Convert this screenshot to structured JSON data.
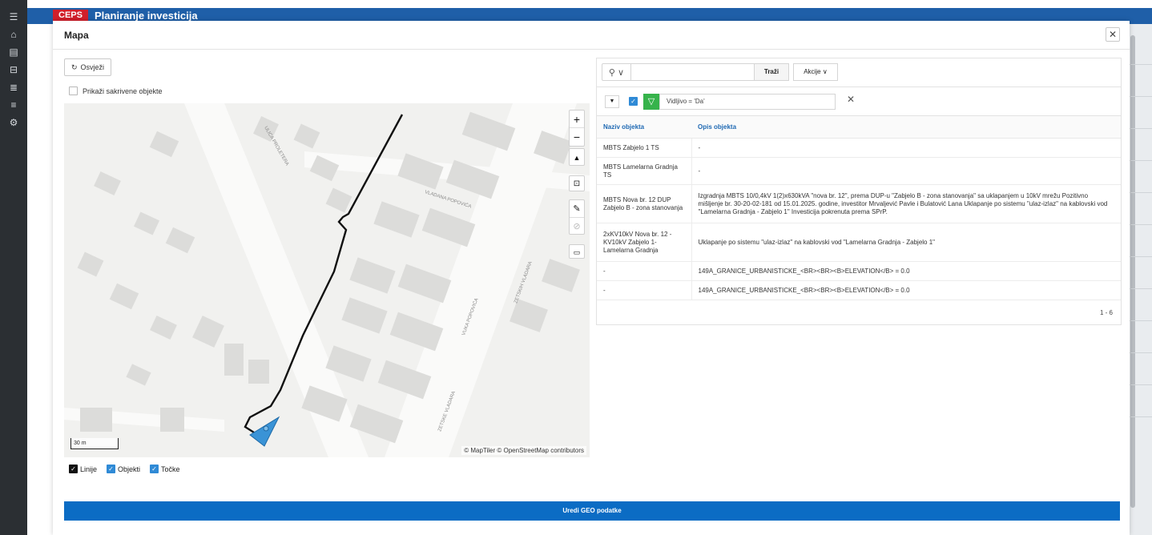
{
  "app": {
    "title": "Planiranje investicija",
    "logo_text": "CEPS"
  },
  "sidebar": {
    "icons": [
      "menu-icon",
      "home-icon",
      "archive-icon",
      "table-icon",
      "list-icon",
      "list-alt-icon",
      "settings-icon"
    ]
  },
  "modal": {
    "title": "Mapa",
    "close_label": "✕",
    "refresh_label": "Osvježi",
    "hidden_objects_label": "Prikaži sakrivene objekte"
  },
  "map": {
    "scale_label": "30 m",
    "attribution": "© MapTiler  © OpenStreetMap contributors",
    "street_labels": [
      "ULICA PROLETERA",
      "VLADANA POPOVIĆA",
      "VUKA POPOVIĆA",
      "ZETSKIH VLADARA",
      "ZETSKE VLADARA"
    ],
    "zoom_in": "+",
    "zoom_out": "−",
    "compass": "▲",
    "legend": {
      "lines": "Linije",
      "objects": "Objekti",
      "points": "Točke"
    }
  },
  "grid": {
    "search_placeholder": "",
    "go_label": "Traži",
    "actions_label": "Akcije ∨",
    "filter_text": "Vidljivo = 'Da'",
    "columns": [
      "Naziv objekta",
      "Opis objekta"
    ],
    "rows": [
      {
        "name": "MBTS Zabjelo 1 TS",
        "desc": "-"
      },
      {
        "name": "MBTS Lamelarna Gradnja TS",
        "desc": "-"
      },
      {
        "name": "MBTS Nova br. 12 DUP Zabjelo B - zona stanovanja",
        "desc": "Izgradnja MBTS 10/0,4kV 1(2)x630kVA \"nova br. 12\", prema DUP-u \"Zabjelo B - zona stanovanja\" sa uklapanjem u 10kV mrežu Pozitivno mišljenje br. 30-20-02-181 od 15.01.2025. godine, investitor Mrvaljević Pavle i Bulatović Lana Uklapanje po sistemu \"ulaz-izlaz\" na kablovski vod \"Lamelarna Gradnja - Zabjelo 1\" Investicija pokrenuta prema SPrP."
      },
      {
        "name": "2xKV10kV Nova br. 12 - KV10kV Zabjelo 1-Lamelarna Gradnja",
        "desc": "Uklapanje po sistemu \"ulaz-izlaz\" na kablovski vod \"Lamelarna Gradnja - Zabjelo 1\""
      },
      {
        "name": "-",
        "desc": "149A_GRANICE_URBANISTICKE_<BR><BR><B>ELEVATION</B> = 0.0"
      },
      {
        "name": "-",
        "desc": "149A_GRANICE_URBANISTICKE_<BR><BR><B>ELEVATION</B> = 0.0"
      }
    ],
    "pagination": "1 - 6"
  },
  "footer": {
    "edit_geo_label": "Uredi GEO podatke"
  },
  "colors": {
    "primary": "#0b6cc4",
    "filter_green": "#36b34b",
    "sidebar": "#2b2f33",
    "checkbox": "#2f8ad6"
  }
}
